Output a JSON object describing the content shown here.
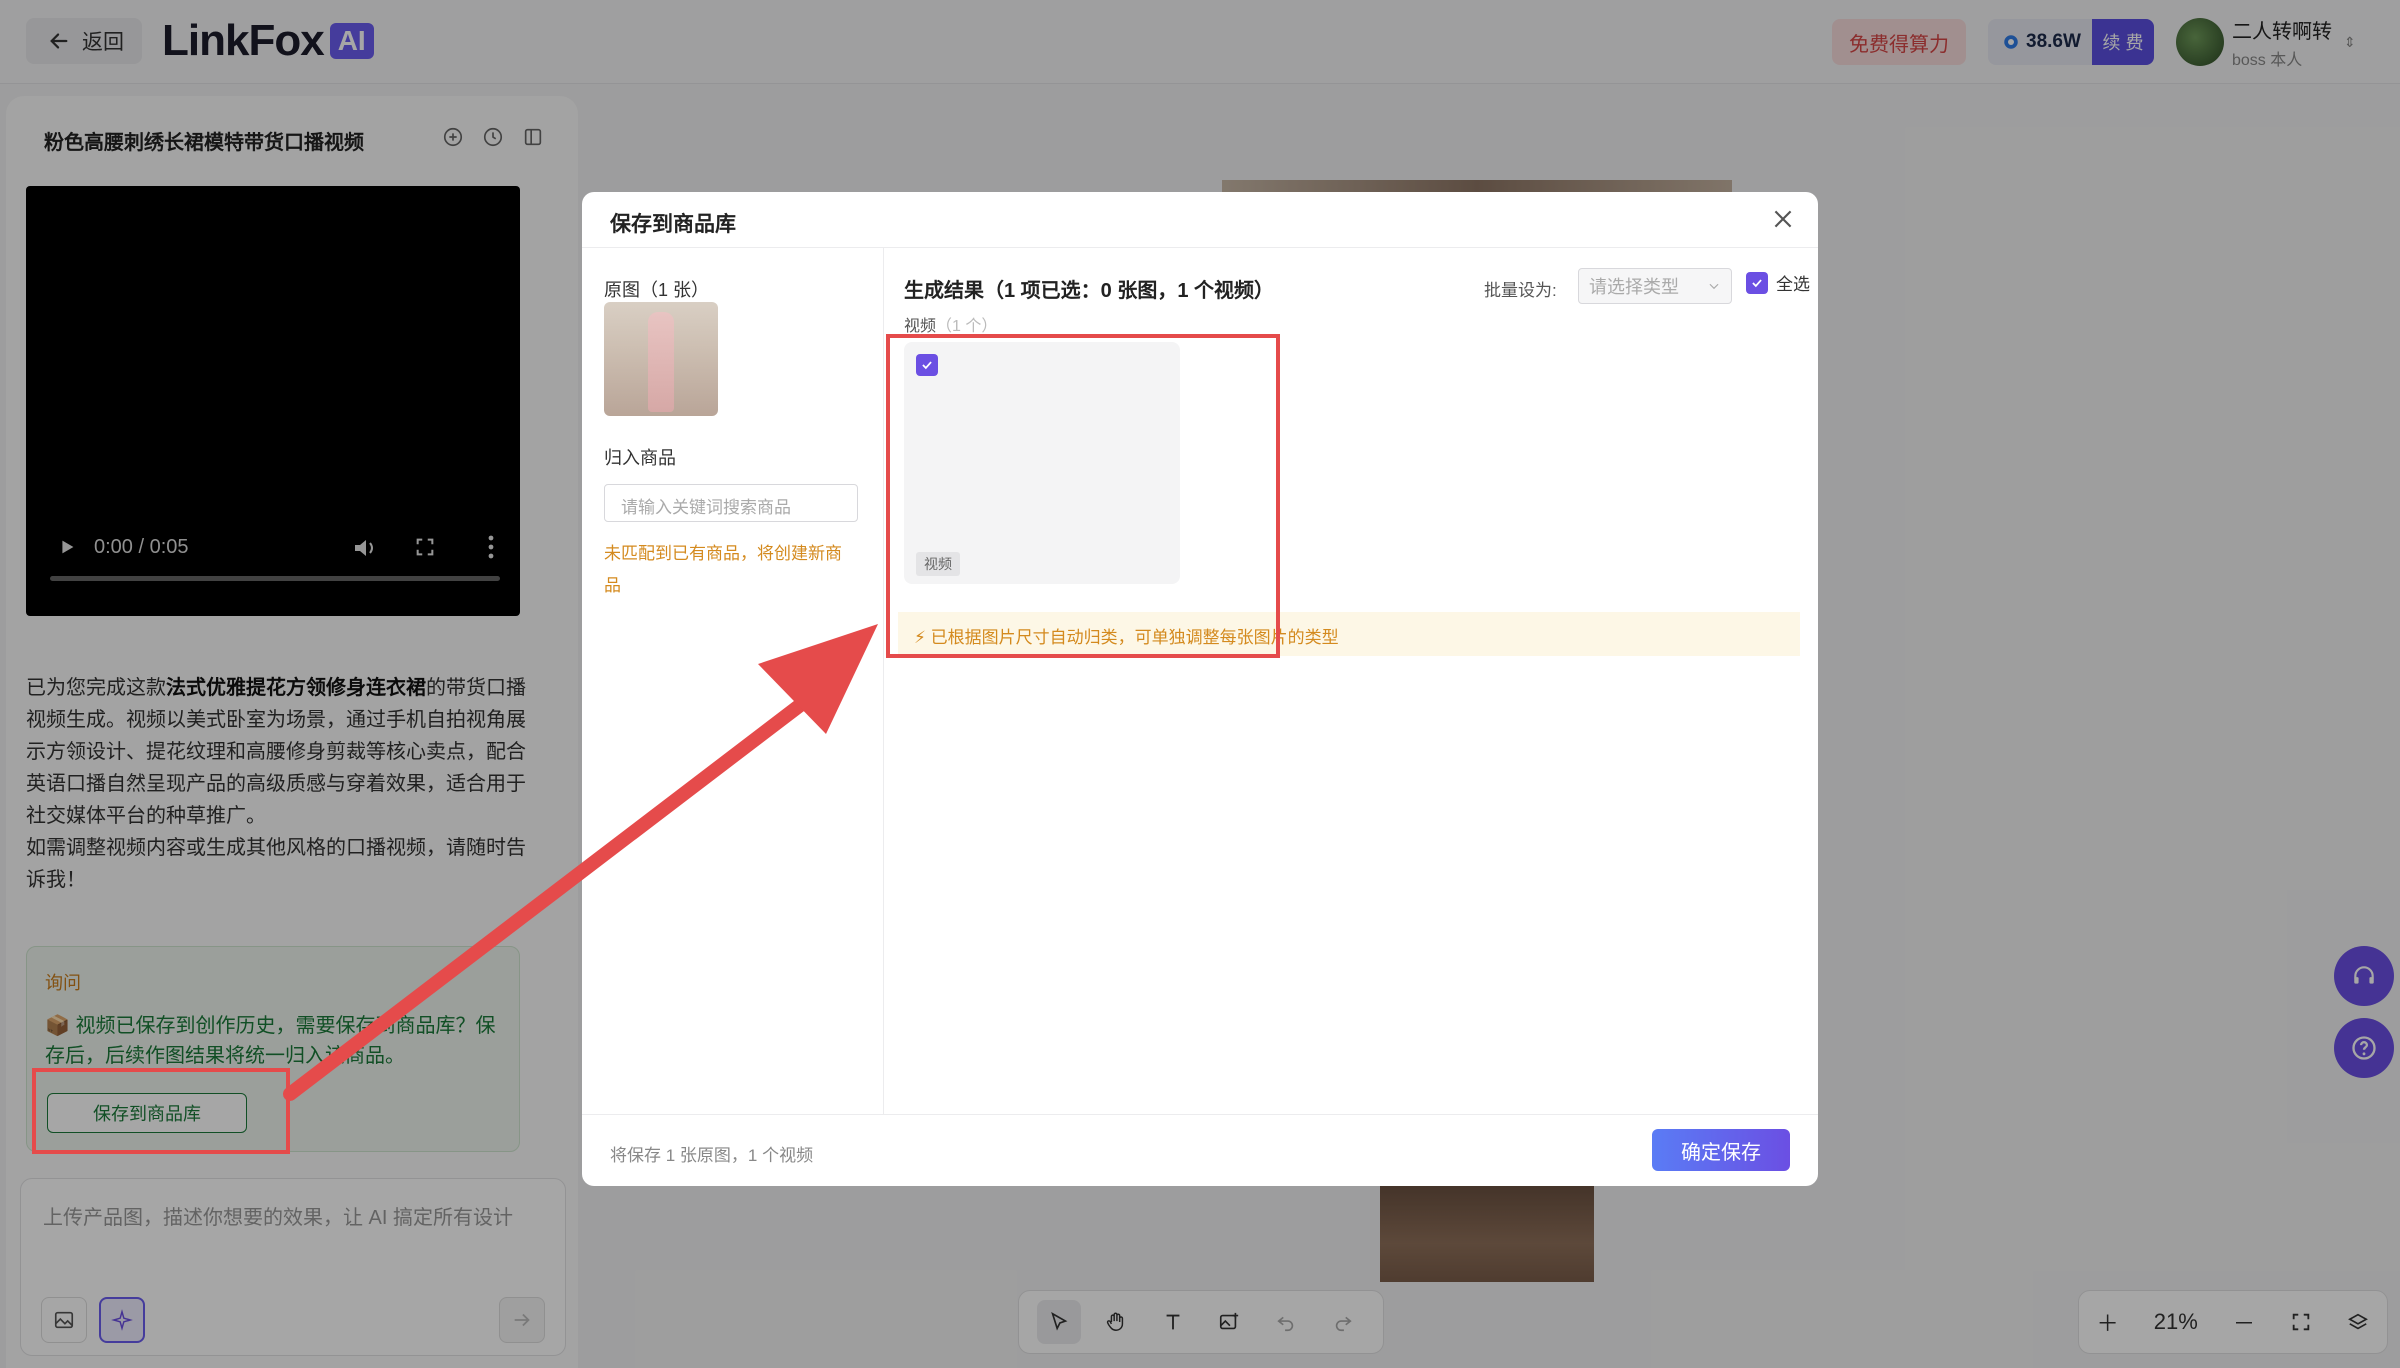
{
  "topbar": {
    "back_label": "返回",
    "logo_text": "LinkFox",
    "logo_badge": "AI",
    "free_compute_label": "免费得算力",
    "credits_value": "38.6W",
    "renew_label": "续 费",
    "user_name": "二人转啊转",
    "user_role": "boss 本人"
  },
  "chat": {
    "title": "粉色高腰刺绣长裙模特带货口播视频",
    "video_time": "0:00 / 0:05",
    "summary_pre": "已为您完成这款",
    "summary_bold": "法式优雅提花方领修身连衣裙",
    "summary_post": "的带货口播视频生成。视频以美式卧室为场景，通过手机自拍视角展示方领设计、提花纹理和高腰修身剪裁等核心卖点，配合英语口播自然呈现产品的高级质感与穿着效果，适合用于社交媒体平台的种草推广。",
    "summary_followup": "如需调整视频内容或生成其他风格的口播视频，请随时告诉我！",
    "ask_label": "询问",
    "ask_text": "📦 视频已保存到创作历史，需要保存到商品库？保存后，后续作图结果将统一归入该商品。",
    "save_library_button": "保存到商品库",
    "input_placeholder": "上传产品图，描述你想要的效果，让 AI 搞定所有设计"
  },
  "canvas": {
    "zoom_level": "21%"
  },
  "modal": {
    "title": "保存到商品库",
    "original_label": "原图（1 张）",
    "assign_label": "归入商品",
    "search_placeholder": "请输入关键词搜索商品",
    "no_match_text": "未匹配到已有商品，将创建新商品",
    "result_title": "生成结果（1 项已选：0 张图，1 个视频）",
    "batch_label": "批量设为:",
    "batch_placeholder": "请选择类型",
    "select_all_label": "全选",
    "video_section_label": "视频",
    "video_section_count": "（1 个）",
    "video_tag": "视频",
    "hint_text": "⚡ 已根据图片尺寸自动归类，可单独调整每张图片的类型",
    "footer_text": "将保存 1 张原图，1 个视频",
    "confirm_button": "确定保存"
  },
  "colors": {
    "accent": "#6b4fe3",
    "annotation_red": "#e54b4b",
    "warning_orange": "#d48a1e",
    "success_green": "#1b7a3a"
  }
}
